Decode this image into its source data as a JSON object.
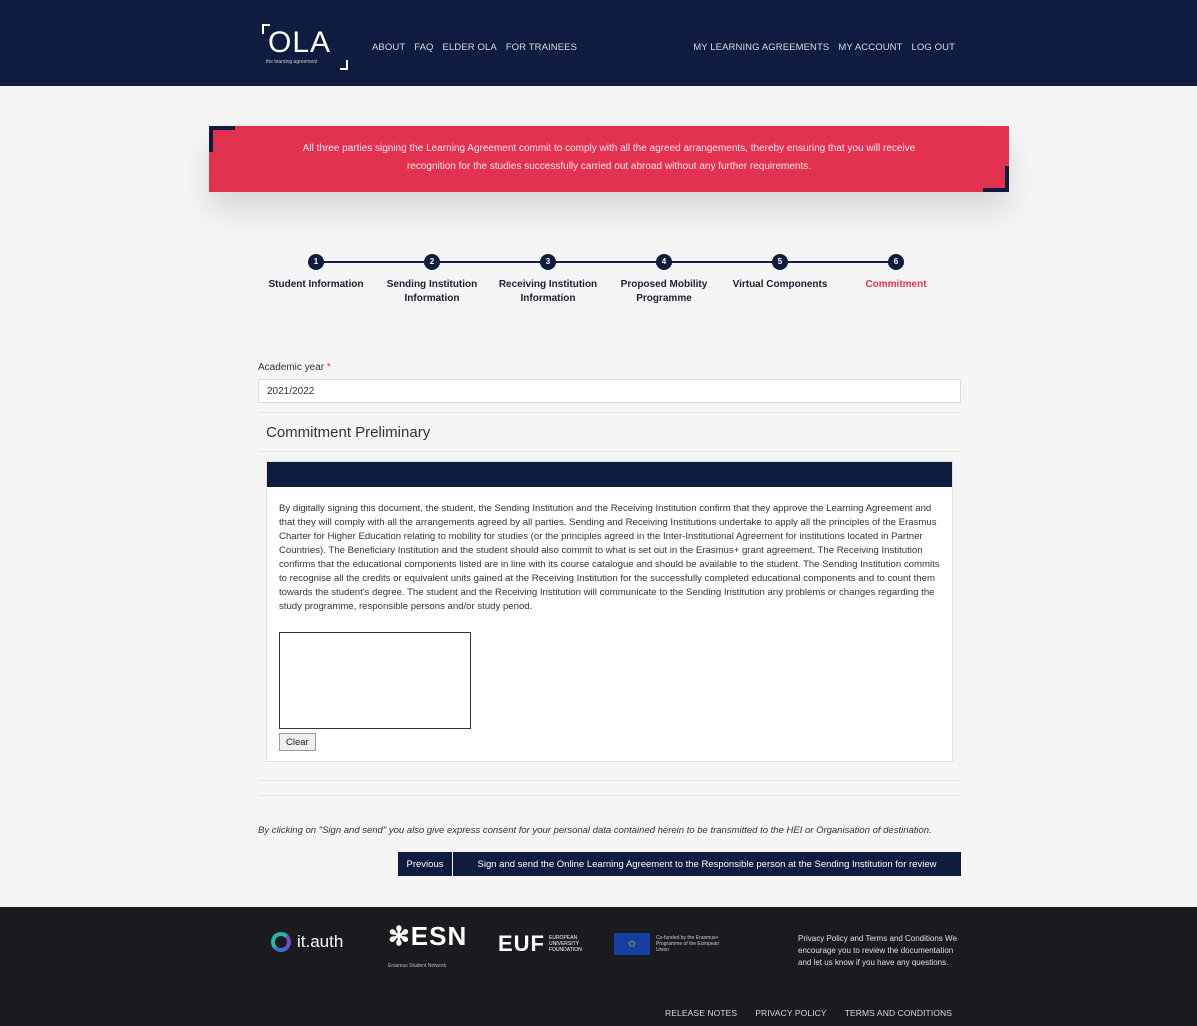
{
  "header": {
    "logo_text": "OLA",
    "logo_tagline": "the learning agreement",
    "nav_left": [
      "ABOUT",
      "FAQ",
      "ELDER OLA",
      "FOR TRAINEES"
    ],
    "nav_right": [
      "MY LEARNING AGREEMENTS",
      "MY ACCOUNT",
      "LOG OUT"
    ]
  },
  "banner": {
    "line1": "All three parties signing the Learning Agreement commit to comply with all the agreed arrangements, thereby ensuring that you will receive",
    "line2": "recognition for the studies successfully carried out abroad without any further requirements."
  },
  "stepper": {
    "steps": [
      {
        "number": "1",
        "label": "Student Information"
      },
      {
        "number": "2",
        "label": "Sending Institution Information"
      },
      {
        "number": "3",
        "label": "Receiving Institution Information"
      },
      {
        "number": "4",
        "label": "Proposed Mobility Programme"
      },
      {
        "number": "5",
        "label": "Virtual Components"
      },
      {
        "number": "6",
        "label": "Commitment"
      }
    ],
    "active_step": "6"
  },
  "form": {
    "academic_year_label": "Academic year",
    "required_mark": "*",
    "academic_year_value": "2021/2022",
    "section_title": "Commitment Preliminary",
    "commitment_text": "By digitally signing this document, the student, the Sending Institution and the Receiving Institution confirm that they approve the Learning Agreement and that they will comply with all the arrangements agreed by all parties. Sending and Receiving Institutions undertake to apply all the principles of the Erasmus Charter for Higher Education relating to mobility for studies (or the principles agreed in the Inter-Institutional Agreement for institutions located in Partner Countries). The Beneficiary Institution and the student should also commit to what is set out in the Erasmus+ grant agreement. The Receiving Institution confirms that the educational components listed are in line with its course catalogue and should be available to the student. The Sending Institution commits to recognise all the credits or equivalent units gained at the Receiving Institution for the successfully completed educational components and to count them towards the student's degree. The student and the Receiving Institution will communicate to the Sending Institution any problems or changes regarding the study programme, responsible persons and/or study period.",
    "clear_label": "Clear",
    "consent_text": "By clicking on \"Sign and send\" you also give express consent for your personal data contained herein to be transmitted to the HEI or Organisation of destination.",
    "previous_label": "Previous",
    "sign_label": "Sign and send the Online Learning Agreement to the Responsible person at the Sending Institution for review"
  },
  "footer": {
    "itauth": "it.auth",
    "esn": "ESN",
    "esn_sub": "Erasmus Student Network",
    "euf": "EUF",
    "euf_sub": "EUROPEAN UNIVERSITY FOUNDATION",
    "eu_text": "Co-funded by the Erasmus+ Programme of the European Union",
    "policy_text": "Privacy Policy and Terms and Conditions We encourage you to review the documentation and let us know if you have any questions.",
    "links": [
      "RELEASE NOTES",
      "PRIVACY POLICY",
      "TERMS AND CONDITIONS"
    ]
  },
  "colors": {
    "navy": "#0f1c3f",
    "accent_red": "#e3324f",
    "footer_bg": "#1a1b1e"
  }
}
